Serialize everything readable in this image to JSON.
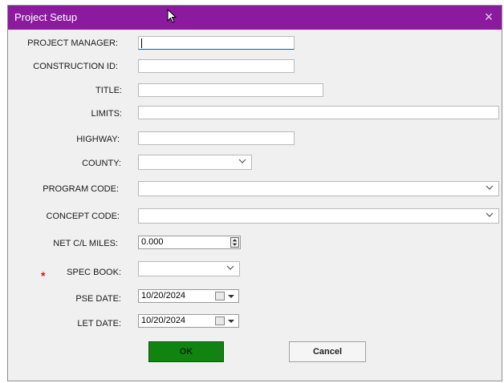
{
  "window": {
    "title": "Project Setup",
    "close_glyph": "×"
  },
  "fields": {
    "project_manager": {
      "label": "PROJECT MANAGER:",
      "value": ""
    },
    "construction_id": {
      "label": "CONSTRUCTION ID:",
      "value": ""
    },
    "title": {
      "label": "TITLE:",
      "value": ""
    },
    "limits": {
      "label": "LIMITS:",
      "value": ""
    },
    "highway": {
      "label": "HIGHWAY:",
      "value": ""
    },
    "county": {
      "label": "COUNTY:",
      "value": ""
    },
    "program_code": {
      "label": "PROGRAM CODE:",
      "value": ""
    },
    "concept_code": {
      "label": "CONCEPT CODE:",
      "value": ""
    },
    "net_cl_miles": {
      "label": "NET C/L MILES:",
      "value": "0.000"
    },
    "spec_book": {
      "label": "SPEC BOOK:",
      "value": "",
      "required_marker": "*"
    },
    "pse_date": {
      "label": "PSE DATE:",
      "value": "10/20/2024"
    },
    "let_date": {
      "label": "LET DATE:",
      "value": "10/20/2024"
    }
  },
  "buttons": {
    "ok": "OK",
    "cancel": "Cancel"
  },
  "colors": {
    "titlebar": "#8b1a9e",
    "ok_button": "#118311",
    "required_marker": "#dd1111"
  },
  "icons": [
    "mouse-cursor-icon",
    "close-icon",
    "chevron-down-icon",
    "spinner-icon",
    "calendar-icon"
  ]
}
